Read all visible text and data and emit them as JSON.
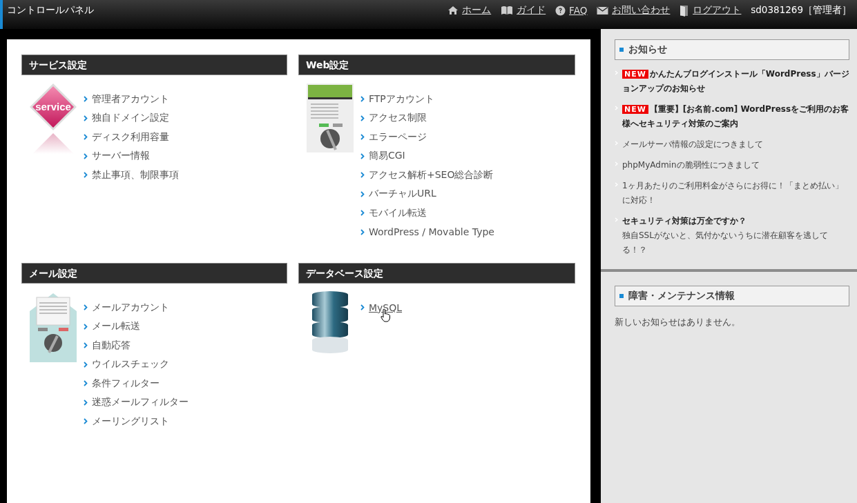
{
  "header": {
    "title": "コントロールパネル",
    "nav": [
      {
        "kind": "home",
        "label": "ホーム"
      },
      {
        "kind": "guide",
        "label": "ガイド"
      },
      {
        "kind": "faq",
        "label": "FAQ"
      },
      {
        "kind": "contact",
        "label": "お問い合わせ"
      },
      {
        "kind": "logout",
        "label": "ログアウト"
      }
    ],
    "user": "sd0381269［管理者］"
  },
  "sections": [
    {
      "title": "サービス設定",
      "kind": "service",
      "logo_text": "service",
      "links": [
        {
          "label": "管理者アカウント",
          "hovered": false
        },
        {
          "label": "独自ドメイン設定",
          "hovered": false
        },
        {
          "label": "ディスク利用容量",
          "hovered": false
        },
        {
          "label": "サーバー情報",
          "hovered": false
        },
        {
          "label": "禁止事項、制限事項",
          "hovered": false
        }
      ]
    },
    {
      "title": "Web設定",
      "kind": "web",
      "links": [
        {
          "label": "FTPアカウント",
          "hovered": false
        },
        {
          "label": "アクセス制限",
          "hovered": false
        },
        {
          "label": "エラーページ",
          "hovered": false
        },
        {
          "label": "簡易CGI",
          "hovered": false
        },
        {
          "label": "アクセス解析+SEO総合診断",
          "hovered": false
        },
        {
          "label": "バーチャルURL",
          "hovered": false
        },
        {
          "label": "モバイル転送",
          "hovered": false
        },
        {
          "label": "WordPress / Movable Type",
          "hovered": false
        }
      ]
    },
    {
      "title": "メール設定",
      "kind": "mail",
      "links": [
        {
          "label": "メールアカウント",
          "hovered": false
        },
        {
          "label": "メール転送",
          "hovered": false
        },
        {
          "label": "自動応答",
          "hovered": false
        },
        {
          "label": "ウイルスチェック",
          "hovered": false
        },
        {
          "label": "条件フィルター",
          "hovered": false
        },
        {
          "label": "迷惑メールフィルター",
          "hovered": false
        },
        {
          "label": "メーリングリスト",
          "hovered": false
        }
      ]
    },
    {
      "title": "データベース設定",
      "kind": "database",
      "links": [
        {
          "label": "MySQL",
          "hovered": true
        }
      ]
    }
  ],
  "news": {
    "title": "お知らせ",
    "items": [
      {
        "badge": "NEW",
        "title": "かんたんブログインストール「WordPress」バージョンアップのお知らせ",
        "bold": true
      },
      {
        "badge": "NEW",
        "title": "【重要】[お名前.com] WordPressをご利用のお客様へセキュリティ対策のご案内",
        "bold": true
      },
      {
        "title": "メールサーバ情報の設定につきまして",
        "bold": false
      },
      {
        "title": "phpMyAdminの脆弱性につきまして",
        "bold": false
      },
      {
        "title": "1ヶ月あたりのご利用料金がさらにお得に！「まとめ払い」に対応！",
        "bold": false
      },
      {
        "title": "セキュリティ対策は万全ですか？",
        "body": "独自SSLがないと、気付かないうちに潜在顧客を逃してる！？",
        "bold": true
      }
    ]
  },
  "maintenance": {
    "title": "障害・メンテナンス情報",
    "message": "新しいお知らせはありません。"
  }
}
